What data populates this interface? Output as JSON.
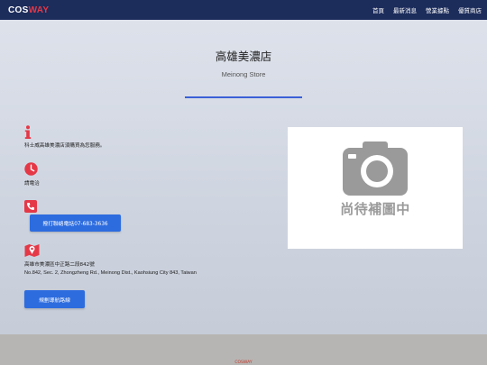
{
  "header": {
    "logo_part1": "COS",
    "logo_part2": "WAY",
    "nav": [
      "首頁",
      "最新消息",
      "營業據點",
      "優質商店"
    ]
  },
  "store": {
    "name": "高雄美濃店",
    "name_en": "Meinong Store"
  },
  "info": {
    "notice": "科士威高雄美濃店須購買為您服務。",
    "hours": "請電洽",
    "call_button": "撥打聯絡電話07-683-3636",
    "address": "高雄市美濃區中正路二段842號",
    "address_en": "No.842, Sec. 2, Zhongzheng Rd., Meinong Dist., Kaohsiung City 843, Taiwan",
    "route_button": "規劃導航路線"
  },
  "photo": {
    "placeholder_text": "尚待補圖中"
  },
  "footer": {
    "text": "COSWAY"
  },
  "colors": {
    "header_bg": "#1c2c5b",
    "accent_red": "#e53847",
    "button_blue": "#2d6cdf",
    "divider_blue": "#3b5fd6"
  }
}
